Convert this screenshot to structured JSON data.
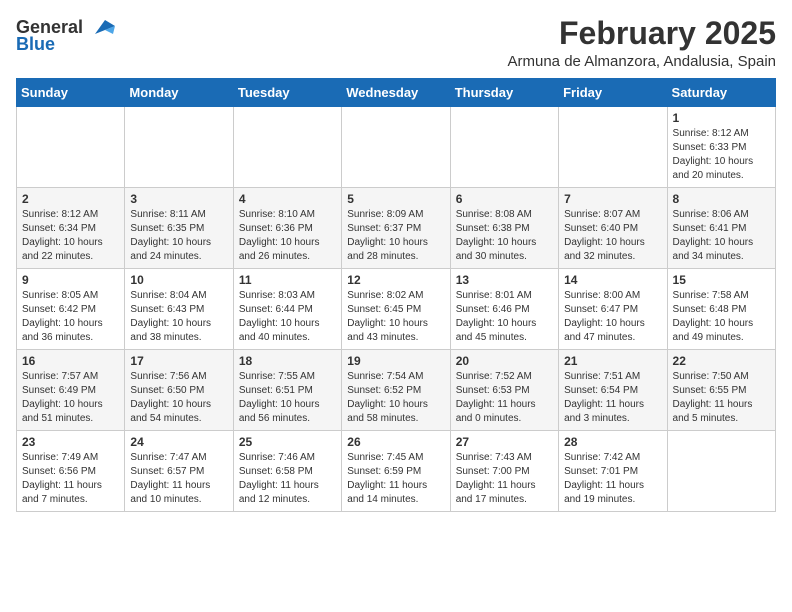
{
  "header": {
    "logo_general": "General",
    "logo_blue": "Blue",
    "month_title": "February 2025",
    "location": "Armuna de Almanzora, Andalusia, Spain"
  },
  "weekdays": [
    "Sunday",
    "Monday",
    "Tuesday",
    "Wednesday",
    "Thursday",
    "Friday",
    "Saturday"
  ],
  "weeks": [
    [
      {
        "day": "",
        "info": ""
      },
      {
        "day": "",
        "info": ""
      },
      {
        "day": "",
        "info": ""
      },
      {
        "day": "",
        "info": ""
      },
      {
        "day": "",
        "info": ""
      },
      {
        "day": "",
        "info": ""
      },
      {
        "day": "1",
        "info": "Sunrise: 8:12 AM\nSunset: 6:33 PM\nDaylight: 10 hours\nand 20 minutes."
      }
    ],
    [
      {
        "day": "2",
        "info": "Sunrise: 8:12 AM\nSunset: 6:34 PM\nDaylight: 10 hours\nand 22 minutes."
      },
      {
        "day": "3",
        "info": "Sunrise: 8:11 AM\nSunset: 6:35 PM\nDaylight: 10 hours\nand 24 minutes."
      },
      {
        "day": "4",
        "info": "Sunrise: 8:10 AM\nSunset: 6:36 PM\nDaylight: 10 hours\nand 26 minutes."
      },
      {
        "day": "5",
        "info": "Sunrise: 8:09 AM\nSunset: 6:37 PM\nDaylight: 10 hours\nand 28 minutes."
      },
      {
        "day": "6",
        "info": "Sunrise: 8:08 AM\nSunset: 6:38 PM\nDaylight: 10 hours\nand 30 minutes."
      },
      {
        "day": "7",
        "info": "Sunrise: 8:07 AM\nSunset: 6:40 PM\nDaylight: 10 hours\nand 32 minutes."
      },
      {
        "day": "8",
        "info": "Sunrise: 8:06 AM\nSunset: 6:41 PM\nDaylight: 10 hours\nand 34 minutes."
      }
    ],
    [
      {
        "day": "9",
        "info": "Sunrise: 8:05 AM\nSunset: 6:42 PM\nDaylight: 10 hours\nand 36 minutes."
      },
      {
        "day": "10",
        "info": "Sunrise: 8:04 AM\nSunset: 6:43 PM\nDaylight: 10 hours\nand 38 minutes."
      },
      {
        "day": "11",
        "info": "Sunrise: 8:03 AM\nSunset: 6:44 PM\nDaylight: 10 hours\nand 40 minutes."
      },
      {
        "day": "12",
        "info": "Sunrise: 8:02 AM\nSunset: 6:45 PM\nDaylight: 10 hours\nand 43 minutes."
      },
      {
        "day": "13",
        "info": "Sunrise: 8:01 AM\nSunset: 6:46 PM\nDaylight: 10 hours\nand 45 minutes."
      },
      {
        "day": "14",
        "info": "Sunrise: 8:00 AM\nSunset: 6:47 PM\nDaylight: 10 hours\nand 47 minutes."
      },
      {
        "day": "15",
        "info": "Sunrise: 7:58 AM\nSunset: 6:48 PM\nDaylight: 10 hours\nand 49 minutes."
      }
    ],
    [
      {
        "day": "16",
        "info": "Sunrise: 7:57 AM\nSunset: 6:49 PM\nDaylight: 10 hours\nand 51 minutes."
      },
      {
        "day": "17",
        "info": "Sunrise: 7:56 AM\nSunset: 6:50 PM\nDaylight: 10 hours\nand 54 minutes."
      },
      {
        "day": "18",
        "info": "Sunrise: 7:55 AM\nSunset: 6:51 PM\nDaylight: 10 hours\nand 56 minutes."
      },
      {
        "day": "19",
        "info": "Sunrise: 7:54 AM\nSunset: 6:52 PM\nDaylight: 10 hours\nand 58 minutes."
      },
      {
        "day": "20",
        "info": "Sunrise: 7:52 AM\nSunset: 6:53 PM\nDaylight: 11 hours\nand 0 minutes."
      },
      {
        "day": "21",
        "info": "Sunrise: 7:51 AM\nSunset: 6:54 PM\nDaylight: 11 hours\nand 3 minutes."
      },
      {
        "day": "22",
        "info": "Sunrise: 7:50 AM\nSunset: 6:55 PM\nDaylight: 11 hours\nand 5 minutes."
      }
    ],
    [
      {
        "day": "23",
        "info": "Sunrise: 7:49 AM\nSunset: 6:56 PM\nDaylight: 11 hours\nand 7 minutes."
      },
      {
        "day": "24",
        "info": "Sunrise: 7:47 AM\nSunset: 6:57 PM\nDaylight: 11 hours\nand 10 minutes."
      },
      {
        "day": "25",
        "info": "Sunrise: 7:46 AM\nSunset: 6:58 PM\nDaylight: 11 hours\nand 12 minutes."
      },
      {
        "day": "26",
        "info": "Sunrise: 7:45 AM\nSunset: 6:59 PM\nDaylight: 11 hours\nand 14 minutes."
      },
      {
        "day": "27",
        "info": "Sunrise: 7:43 AM\nSunset: 7:00 PM\nDaylight: 11 hours\nand 17 minutes."
      },
      {
        "day": "28",
        "info": "Sunrise: 7:42 AM\nSunset: 7:01 PM\nDaylight: 11 hours\nand 19 minutes."
      },
      {
        "day": "",
        "info": ""
      }
    ]
  ]
}
